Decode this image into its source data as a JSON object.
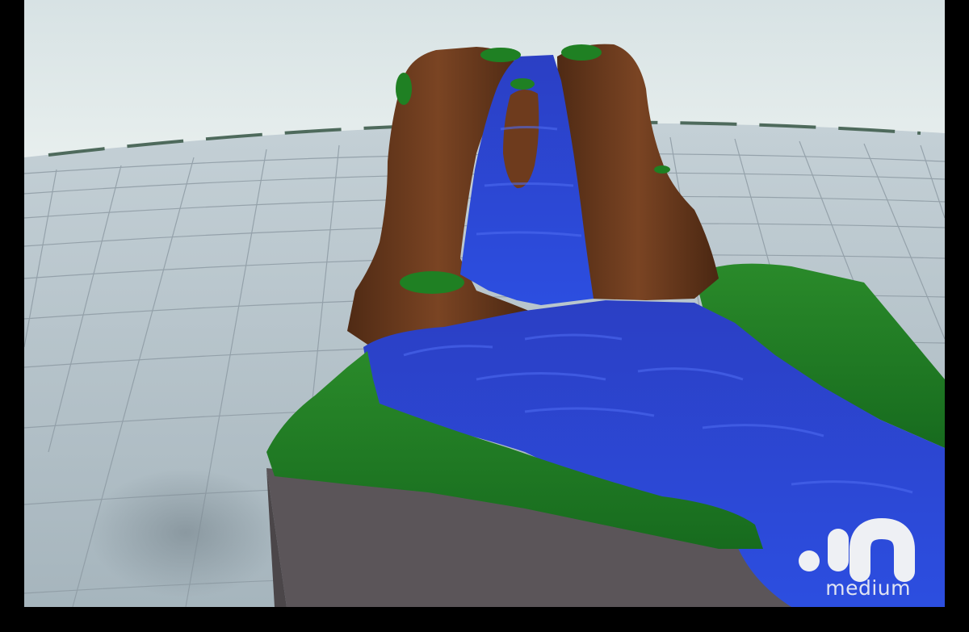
{
  "scene": {
    "colors": {
      "sky": "#dde6e7",
      "floor": "#aebcc4",
      "grid": "#8d9aa3",
      "rock": "#6b3a1e",
      "grass": "#1d7a22",
      "water": "#2a46cf",
      "base": "#5b5559"
    }
  },
  "logo": {
    "name": "inmedium-logo",
    "caption": "medium"
  }
}
